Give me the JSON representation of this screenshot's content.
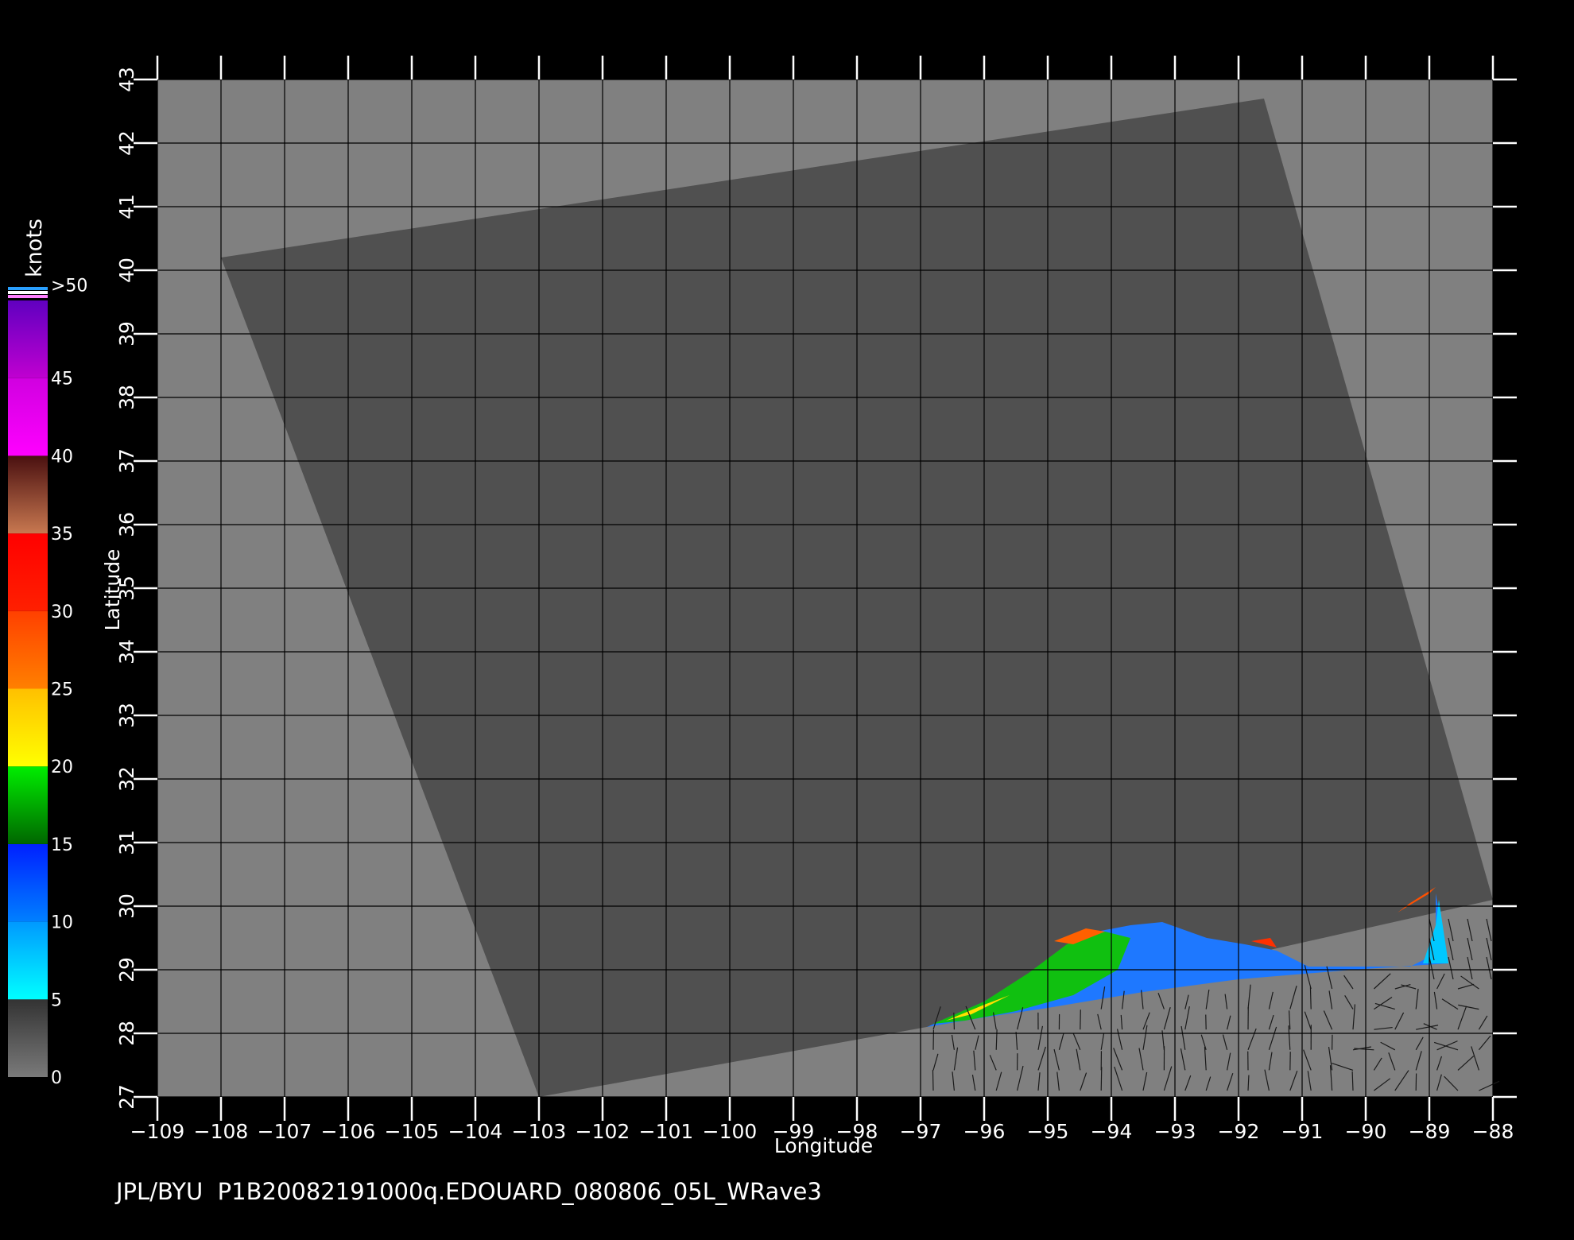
{
  "map": {
    "x_axis_label": "Longitude",
    "y_axis_label": "Latitude",
    "lon_range": [
      -109,
      -88
    ],
    "lat_range": [
      27,
      43
    ],
    "lon_ticks": [
      -109,
      -108,
      -107,
      -106,
      -105,
      -104,
      -103,
      -102,
      -101,
      -100,
      -99,
      -98,
      -97,
      -96,
      -95,
      -94,
      -93,
      -92,
      -91,
      -90,
      -89,
      -88
    ],
    "lat_ticks": [
      27,
      28,
      29,
      30,
      31,
      32,
      33,
      34,
      35,
      36,
      37,
      38,
      39,
      40,
      41,
      42,
      43
    ],
    "tick_labels_x": [
      "−109",
      "−108",
      "−107",
      "−106",
      "−105",
      "−104",
      "−103",
      "−102",
      "−101",
      "−100",
      "−99",
      "−98",
      "−97",
      "−96",
      "−95",
      "−94",
      "−93",
      "−92",
      "−91",
      "−90",
      "−89",
      "−88"
    ],
    "tick_labels_y": [
      "27",
      "28",
      "29",
      "30",
      "31",
      "32",
      "33",
      "34",
      "35",
      "36",
      "37",
      "38",
      "39",
      "40",
      "41",
      "42",
      "43"
    ],
    "grid": true,
    "colors": {
      "background": "#000000",
      "land": "#808080",
      "swath": "#505050",
      "grid": "#000000"
    },
    "swath_corners_lonlat": [
      [
        -108.0,
        40.2
      ],
      [
        -91.6,
        42.7
      ],
      [
        -88.0,
        30.1
      ],
      [
        -96.9,
        28.1
      ],
      [
        -103.0,
        27.0
      ]
    ]
  },
  "legend": {
    "title": "knots",
    "labels": [
      ">50",
      "45",
      "40",
      "35",
      "30",
      "25",
      "20",
      "15",
      "10",
      "5",
      "0"
    ],
    "bands": [
      {
        "from": 0,
        "to": 5,
        "colors": [
          "#7a7a7a",
          "#333333"
        ]
      },
      {
        "from": 5,
        "to": 10,
        "colors": [
          "#00ffff",
          "#0099ff"
        ]
      },
      {
        "from": 10,
        "to": 15,
        "colors": [
          "#0080ff",
          "#0020ff"
        ]
      },
      {
        "from": 15,
        "to": 20,
        "colors": [
          "#006600",
          "#00ee00"
        ]
      },
      {
        "from": 20,
        "to": 25,
        "colors": [
          "#ffff00",
          "#ffc000"
        ]
      },
      {
        "from": 25,
        "to": 30,
        "colors": [
          "#ff8000",
          "#ff4000"
        ]
      },
      {
        "from": 30,
        "to": 35,
        "colors": [
          "#ff2000",
          "#ff0000"
        ]
      },
      {
        "from": 35,
        "to": 40,
        "colors": [
          "#c87850",
          "#4a1010"
        ]
      },
      {
        "from": 40,
        "to": 45,
        "colors": [
          "#ff00ff",
          "#d000e0"
        ]
      },
      {
        "from": 45,
        "to": 50,
        "colors": [
          "#c000d0",
          "#6000c0"
        ]
      }
    ]
  },
  "footer": {
    "text": "JPL/BYU  P1B20082191000q.EDOUARD_080806_05L_WRave3"
  }
}
